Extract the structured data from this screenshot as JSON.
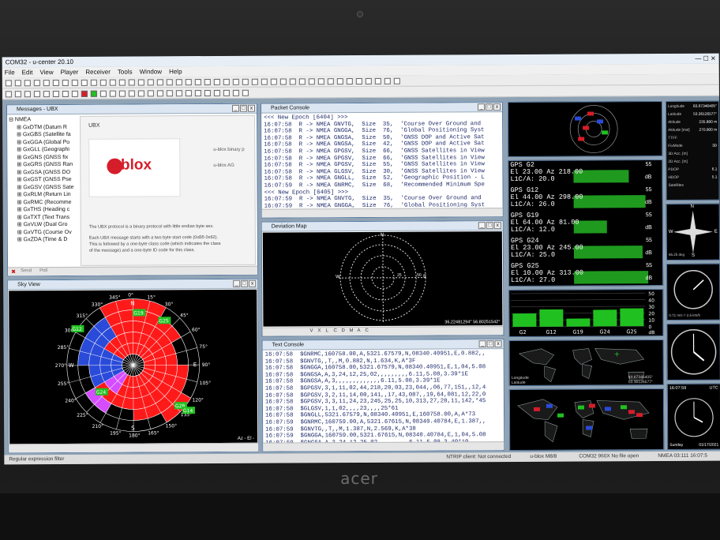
{
  "app": {
    "title": "COM32 - u-center 20.10",
    "menu": [
      "File",
      "Edit",
      "View",
      "Player",
      "Receiver",
      "Tools",
      "Window",
      "Help"
    ]
  },
  "messages_window": {
    "title": "Messages - UBX",
    "tree": [
      "NMEA",
      "GxDTM (Datum R",
      "GxGBS (Satellite fa",
      "GxGGA (Global Po",
      "GxGLL (Geographi",
      "GxGNS (GNSS fix",
      "GxGRS (GNSS Ran",
      "GxGSA (GNSS DO",
      "GxGST (GNSS Pse",
      "GxGSV (GNSS Sate",
      "GxRLM (Return Lin",
      "GxRMC (Recomme",
      "GxTHS (Heading c",
      "GxTXT (Text Trans",
      "GxVLW (Dual Gro",
      "GxVTG (Course Ov",
      "GxZDA (Time & D"
    ],
    "panel_label": "UBX",
    "logo_text": "ublox",
    "side_text_1": "u-blox binary p",
    "side_text_2": "u-blox AG",
    "desc_1": "The UBX protocol is a binary protocol with little endian byte sex.",
    "desc_2": "Each UBX message starts with a two byte start code (0xB5 0x62).",
    "desc_3": "This is followed by a one-byte class code (which indicates the class",
    "desc_4": "of the message) and a one-byte ID code for this class.",
    "send_label": "Send",
    "poll_label": "Poll"
  },
  "packet_console": {
    "title": "Packet Console",
    "lines": [
      "<<< New Epoch [6404] >>>",
      "16:07:58  R -> NMEA GNVTG,  Size  35,  'Course Over Ground and",
      "16:07:58  R -> NMEA GNGGA,  Size  76,  'Global Positioning Syst",
      "16:07:58  R -> NMEA GNGSA,  Size  50,  'GNSS DOP and Active Sat",
      "16:07:58  R -> NMEA GNGSA,  Size  42,  'GNSS DOP and Active Sat",
      "16:07:58  R -> NMEA GPGSV,  Size  66,  'GNSS Satellites in View",
      "16:07:58  R -> NMEA GPGSV,  Size  66,  'GNSS Satellites in View",
      "16:07:58  R -> NMEA GPGSV,  Size  55,  'GNSS Satellites in View",
      "16:07:58  R -> NMEA GLGSV,  Size  30,  'GNSS Satellites in View",
      "16:07:58  R -> NMEA GNGLL,  Size  52,  'Geographic Position - L",
      "16:07:59  R -> NMEA GNRMC,  Size  68,  'Recommended Minimum Spe",
      "<<< New Epoch [6405] >>>",
      "16:07:59  R -> NMEA GNVTG,  Size  35,  'Course Over Ground and",
      "16:07:59  R -> NMEA GNGGA,  Size  76,  'Global Positioning Syst"
    ]
  },
  "deviation_map": {
    "title": "Deviation Map",
    "north": "N",
    "west": "W",
    "east": "E",
    "ring_25": "25",
    "ring_50": "50",
    "coords": "36.22481294° 56.80251542°",
    "tools": [
      "V",
      "X",
      "L",
      "C",
      "D",
      "M",
      "A",
      "C"
    ]
  },
  "text_console": {
    "title": "Text Console",
    "lines": [
      "16:07:58  $GNRMC,160758.00,A,5321.67579,N,08340.40951,E,0.882,,",
      "16:07:58  $GNVTG,,T,,M,0.882,N,1.634,K,A*3F",
      "16:07:58  $GNGGA,160758.00,5321.67579,N,08340.40951,E,1,04,5.08",
      "16:07:58  $GNGSA,A,3,24,12,25,02,,,,,,,,,6.11,5.08,3.39*1E",
      "16:07:58  $GNGSA,A,3,,,,,,,,,,,,,6.11,5.08,3.39*1E",
      "16:07:58  $GPGSV,3,1,11,02,44,218,20,03,23,044,,06,77,151,,12,4",
      "16:07:58  $GPGSV,3,2,11,14,00,141,,17,43,087,,19,64,081,12,22,0",
      "16:07:58  $GPGSV,3,3,11,24,23,245,25,25,10,313,27,28,11,142,*45",
      "16:07:58  $GLGSV,1,1,02,,,,23,,,,25*61",
      "16:07:58  $GNGLL,5321.67579,N,08340.40951,E,160758.00,A,A*73",
      "16:07:59  $GNRMC,160759.00,A,5321.67615,N,08340.40784,E,1.387,,",
      "16:07:59  $GNVTG,,T,,M,1.387,N,2.569,K,A*38",
      "16:07:59  $GNGGA,160759.00,5321.67615,N,08340.40784,E,1,04,5.08",
      "16:07:59  $GNGSA,A,3,24,12,25,02,,,,,,,,,6.11,5.08,3.40*10"
    ]
  },
  "sky_view": {
    "title": "Sky View",
    "deg_labels": [
      "345°",
      "0°",
      "15°",
      "30°",
      "45°",
      "60°",
      "75°",
      "90°",
      "105°",
      "120°",
      "135°",
      "150°",
      "165°",
      "180°",
      "195°",
      "210°",
      "225°",
      "240°",
      "255°",
      "270°",
      "285°",
      "300°",
      "315°",
      "330°"
    ],
    "cardinals": {
      "n": "N",
      "e": "E",
      "s": "S",
      "w": "W"
    },
    "sats": [
      "G19",
      "G12",
      "G24",
      "G25",
      "G28",
      "G14"
    ],
    "corner": "Az - El -",
    "colors": {
      "red": "#ff1a1a",
      "blue": "#2a4bd9",
      "magenta": "#d44dff",
      "green": "#20c020"
    }
  },
  "satellites": [
    {
      "label": "GPS G2",
      "az": "El 23.00 Az 218.00",
      "cno": "L1C/A: 20.0",
      "level": 0.4
    },
    {
      "label": "GPS G12",
      "az": "El 44.00 Az 298.00",
      "cno": "L1C/A: 26.0",
      "level": 0.52
    },
    {
      "label": "GPS G19",
      "az": "El 64.00 Az 81.00",
      "cno": "L1C/A: 12.0",
      "level": 0.24
    },
    {
      "label": "GPS G24",
      "az": "El 23.00 Az 245.00",
      "cno": "L1C/A: 25.0",
      "level": 0.5
    },
    {
      "label": "GPS G25",
      "az": "El 10.00 Az 313.00",
      "cno": "L1C/A: 27.0",
      "level": 0.54
    }
  ],
  "signal_scale": [
    "55",
    "dB",
    "55",
    "dB",
    "55",
    "dB",
    "55",
    "dB",
    "55",
    "dB"
  ],
  "bar_chart": {
    "sats": [
      "G2",
      "G12",
      "G19",
      "G24",
      "G25"
    ],
    "levels": [
      0.4,
      0.52,
      0.24,
      0.5,
      0.54
    ],
    "ticks": [
      "50",
      "40",
      "30",
      "20",
      "10",
      "0"
    ],
    "unit": "dB"
  },
  "world_map": {
    "lat_label": "Longitude",
    "lat_val": "83.67346405°",
    "lon_label": "Latitude",
    "lon_val": "53.36126577°"
  },
  "data_panel": {
    "rows": [
      {
        "k": "Longitude",
        "v": "83.67346405°"
      },
      {
        "k": "Latitude",
        "v": "53.36126577°"
      },
      {
        "k": "Altitude",
        "v": "235.880 m"
      },
      {
        "k": "Altitude [msl]",
        "v": "270.900 m"
      },
      {
        "k": "TTFF",
        "v": ""
      },
      {
        "k": "FixMode",
        "v": "3D"
      },
      {
        "k": "3D Acc. [m]",
        "v": ""
      },
      {
        "k": "2D Acc. [m]",
        "v": ""
      },
      {
        "k": "PDOP",
        "v": "6.1"
      },
      {
        "k": "HDOP",
        "v": "5.1"
      },
      {
        "k": "Satellites",
        "v": ""
      }
    ]
  },
  "compass": {
    "n": "N",
    "s": "S",
    "e": "E",
    "w": "W",
    "heading": "65.25 deg"
  },
  "speedo": {
    "value": "0.71 m/s = 2.6 km/h"
  },
  "clock": {
    "time": "16:07:59",
    "zone": "UTC",
    "day": "Sunday",
    "date": "01/17/2021"
  },
  "statusbar": {
    "left": "Regular expression filter",
    "ntrip": "NTRIP client: Not connected",
    "device": "u-blox M8/8",
    "port": "COM32 960X  No file open",
    "nmea": "NMEA 03:111  16:07:5"
  },
  "brand": "acer"
}
